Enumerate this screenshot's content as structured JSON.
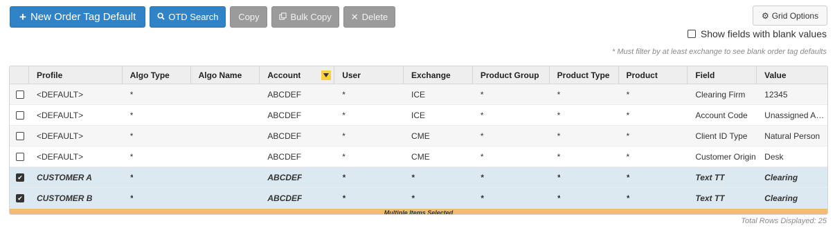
{
  "toolbar": {
    "new_label": "New Order Tag Default",
    "otd_search_label": "OTD Search",
    "copy_label": "Copy",
    "bulk_copy_label": "Bulk Copy",
    "delete_label": "Delete",
    "icons": {
      "new": "plus-icon",
      "search": "search-icon",
      "bulk_copy": "copy-icon",
      "delete": "times-icon"
    }
  },
  "grid_options": {
    "label": "Grid Options",
    "icon": "gear-icon"
  },
  "blank_values_toggle": {
    "label": "Show fields with blank values",
    "checked": false
  },
  "filter_note": "* Must filter by at least exchange to see blank order tag defaults",
  "columns": {
    "profile": "Profile",
    "algo_type": "Algo Type",
    "algo_name": "Algo Name",
    "account": "Account",
    "user": "User",
    "exchange": "Exchange",
    "product_group": "Product Group",
    "product_type": "Product Type",
    "product": "Product",
    "field": "Field",
    "value": "Value"
  },
  "rows": [
    {
      "profile": "<DEFAULT>",
      "algo_type": "*",
      "algo_name": "",
      "account": "ABCDEF",
      "user": "*",
      "exchange": "ICE",
      "product_group": "*",
      "product_type": "*",
      "product": "*",
      "field": "Clearing Firm",
      "value": "12345"
    },
    {
      "profile": "<DEFAULT>",
      "algo_type": "*",
      "algo_name": "",
      "account": "ABCDEF",
      "user": "*",
      "exchange": "ICE",
      "product_group": "*",
      "product_type": "*",
      "product": "*",
      "field": "Account Code",
      "value": "Unassigned Account"
    },
    {
      "profile": "<DEFAULT>",
      "algo_type": "*",
      "algo_name": "",
      "account": "ABCDEF",
      "user": "*",
      "exchange": "CME",
      "product_group": "*",
      "product_type": "*",
      "product": "*",
      "field": "Client ID Type",
      "value": "Natural Person"
    },
    {
      "profile": "<DEFAULT>",
      "algo_type": "*",
      "algo_name": "",
      "account": "ABCDEF",
      "user": "*",
      "exchange": "CME",
      "product_group": "*",
      "product_type": "*",
      "product": "*",
      "field": "Customer Origin",
      "value": "Desk"
    },
    {
      "profile": "CUSTOMER A",
      "algo_type": "*",
      "algo_name": "",
      "account": "ABCDEF",
      "user": "*",
      "exchange": "*",
      "product_group": "*",
      "product_type": "*",
      "product": "*",
      "field": "Text TT",
      "value": "Clearing"
    },
    {
      "profile": "CUSTOMER B",
      "algo_type": "*",
      "algo_name": "",
      "account": "ABCDEF",
      "user": "*",
      "exchange": "*",
      "product_group": "*",
      "product_type": "*",
      "product": "*",
      "field": "Text TT",
      "value": "Clearing"
    }
  ],
  "selection_banner": "Multiple Items Selected",
  "footer": "Total Rows Displayed: 25",
  "colors": {
    "primary": "#2f83c6",
    "disabled": "#9b9b9b",
    "selected_row": "#dce9f0",
    "selection_banner": "#f0bd6e",
    "filter_active": "#f4d13d"
  }
}
